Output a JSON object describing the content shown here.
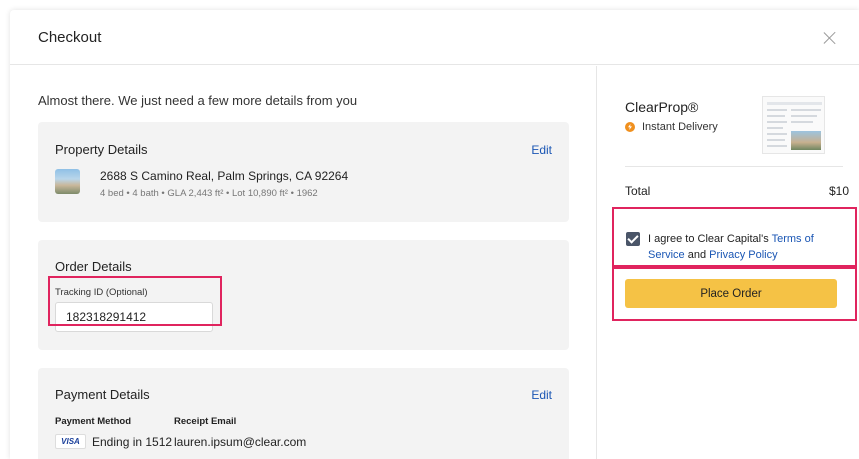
{
  "modal": {
    "title": "Checkout",
    "close_icon": "close-icon"
  },
  "intro": "Almost there. We just need a few more details from you",
  "property": {
    "title": "Property Details",
    "edit": "Edit",
    "address": "2688 S Camino Real, Palm Springs, CA 92264",
    "meta": "4 bed • 4 bath • GLA 2,443 ft² • Lot 10,890 ft² • 1962"
  },
  "order": {
    "title": "Order Details",
    "tracking_label": "Tracking ID (Optional)",
    "tracking_value": "182318291412"
  },
  "payment": {
    "title": "Payment Details",
    "edit": "Edit",
    "method_label": "Payment Method",
    "card_brand": "VISA",
    "ending": "Ending in 1512",
    "receipt_label": "Receipt Email",
    "receipt_email": "lauren.ipsum@clear.com"
  },
  "summary": {
    "product": "ClearProp®",
    "delivery": "Instant Delivery",
    "total_label": "Total",
    "total_value": "$10",
    "agree_prefix": "I agree to Clear Capital's ",
    "terms": "Terms of Service",
    "and": " and ",
    "privacy": "Privacy Policy",
    "agree_checked": true,
    "place_order": "Place Order"
  },
  "colors": {
    "highlight": "#e0245e",
    "link": "#1a56b4",
    "button": "#f5c245",
    "card_bg": "#f3f3f3",
    "delivery_icon": "#f0901e"
  }
}
